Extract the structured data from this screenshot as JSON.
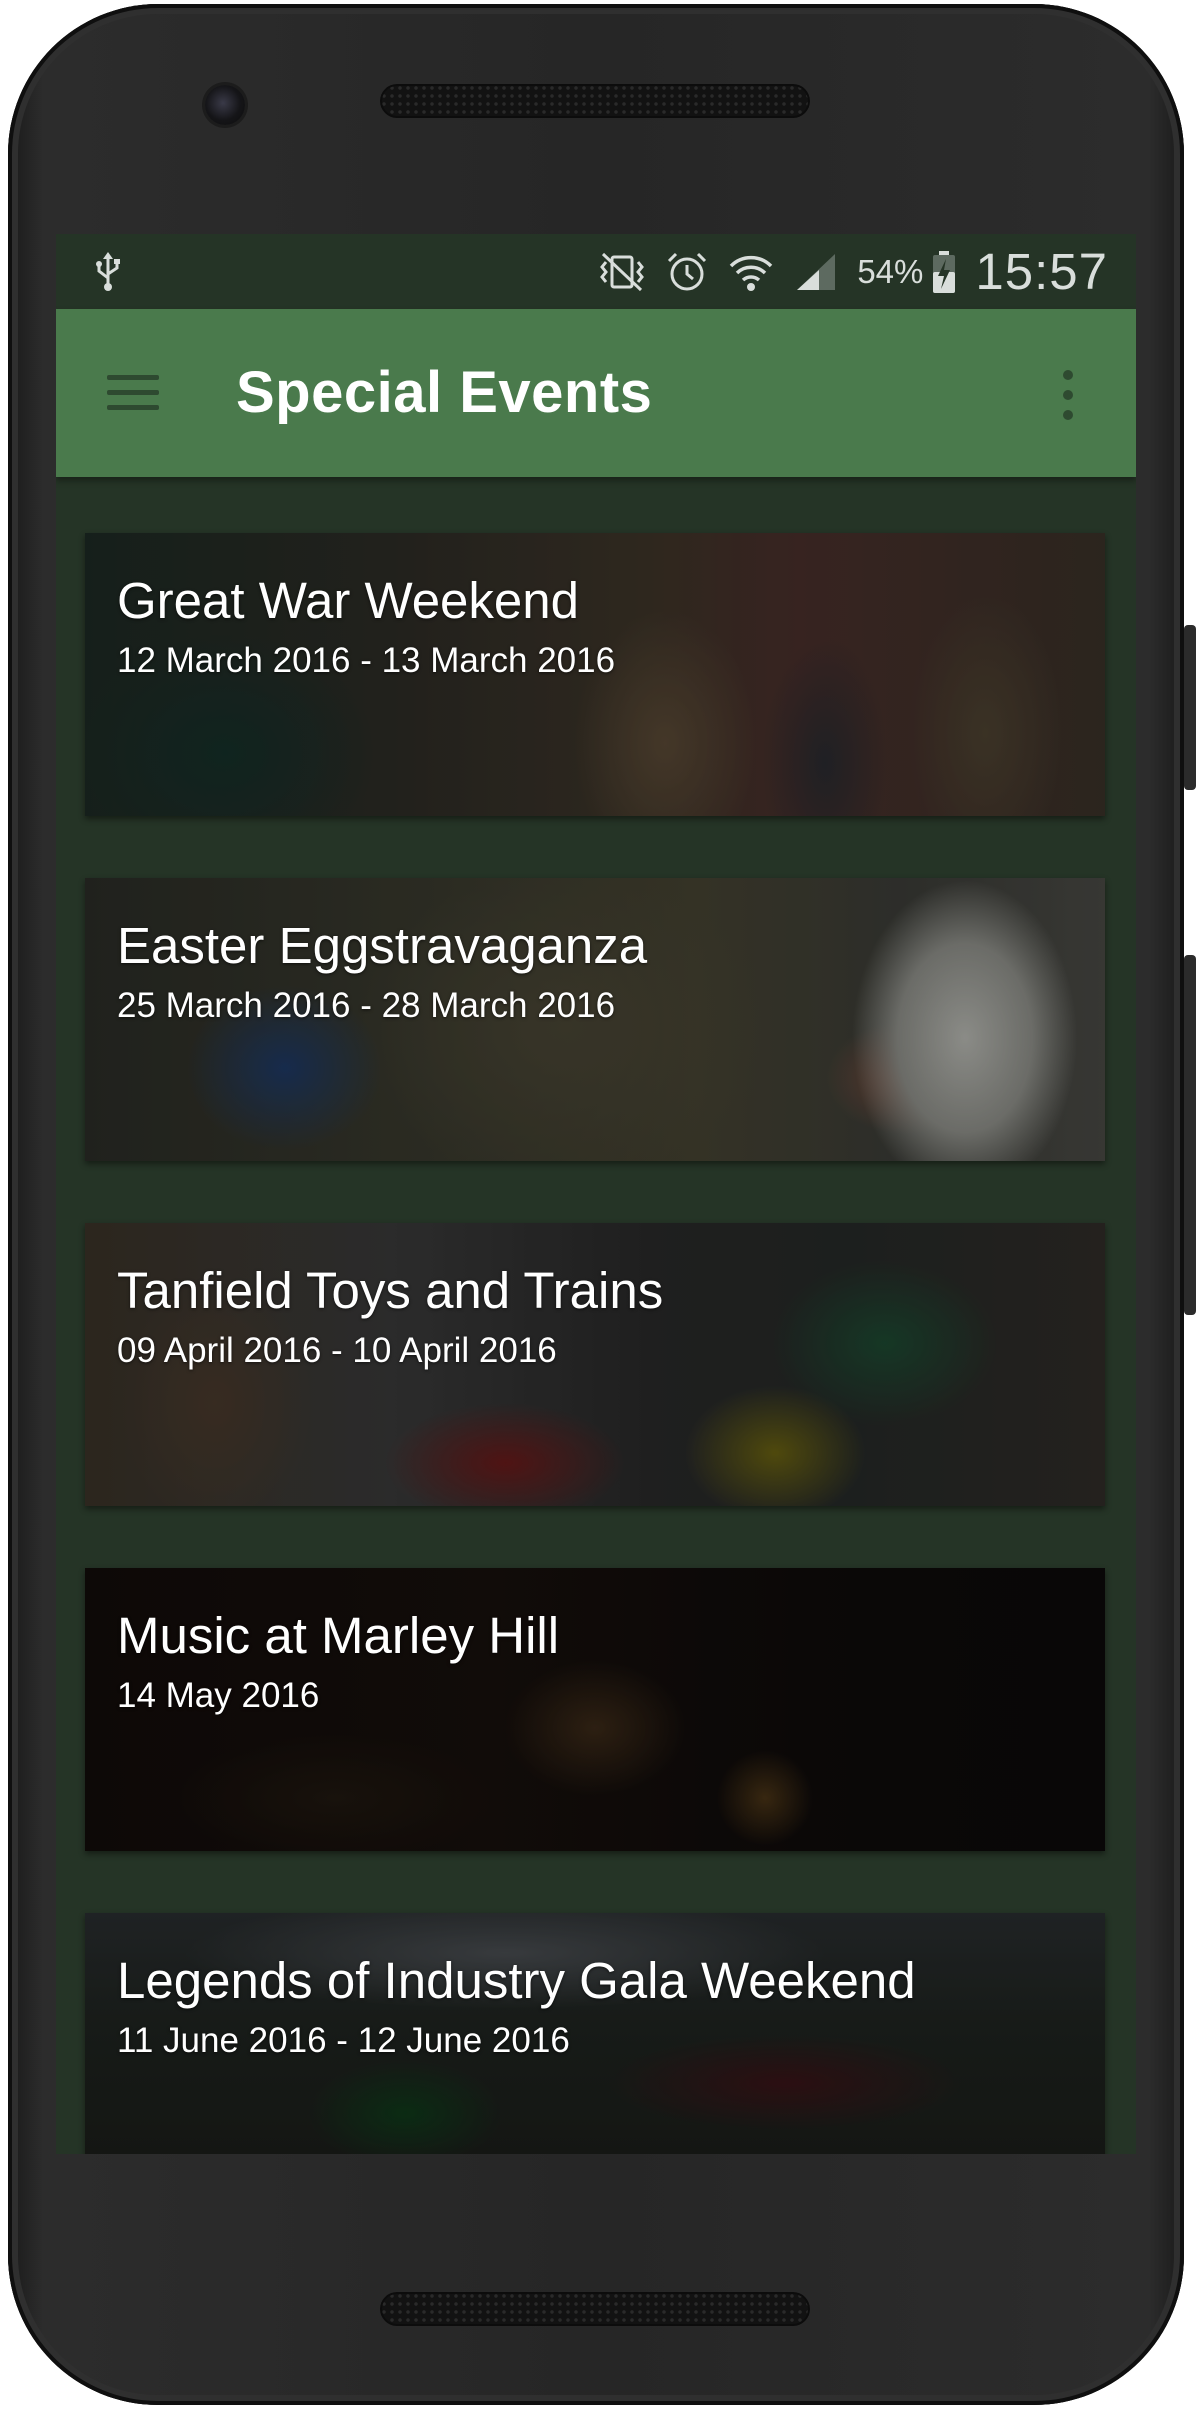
{
  "statusbar": {
    "icons": [
      "usb-icon",
      "vibrate-mute-icon",
      "alarm-icon",
      "wifi-icon",
      "signal-icon",
      "battery-charging-icon"
    ],
    "battery_percent": "54%",
    "time": "15:57"
  },
  "appbar": {
    "title": "Special Events",
    "menu_icon": "hamburger-menu-icon",
    "overflow_icon": "more-vert-icon"
  },
  "events": [
    {
      "name": "Great War Weekend",
      "dates": "12 March 2016 - 13 March 2016"
    },
    {
      "name": "Easter Eggstravaganza",
      "dates": "25 March 2016 - 28 March 2016"
    },
    {
      "name": "Tanfield Toys and Trains",
      "dates": "09 April 2016 - 10 April 2016"
    },
    {
      "name": "Music at Marley Hill",
      "dates": "14 May 2016"
    },
    {
      "name": "Legends of Industry Gala Weekend",
      "dates": "11 June 2016 - 12 June 2016"
    }
  ],
  "colors": {
    "appbar": "#4a7a4c",
    "background": "#253426",
    "text": "#ffffff"
  }
}
